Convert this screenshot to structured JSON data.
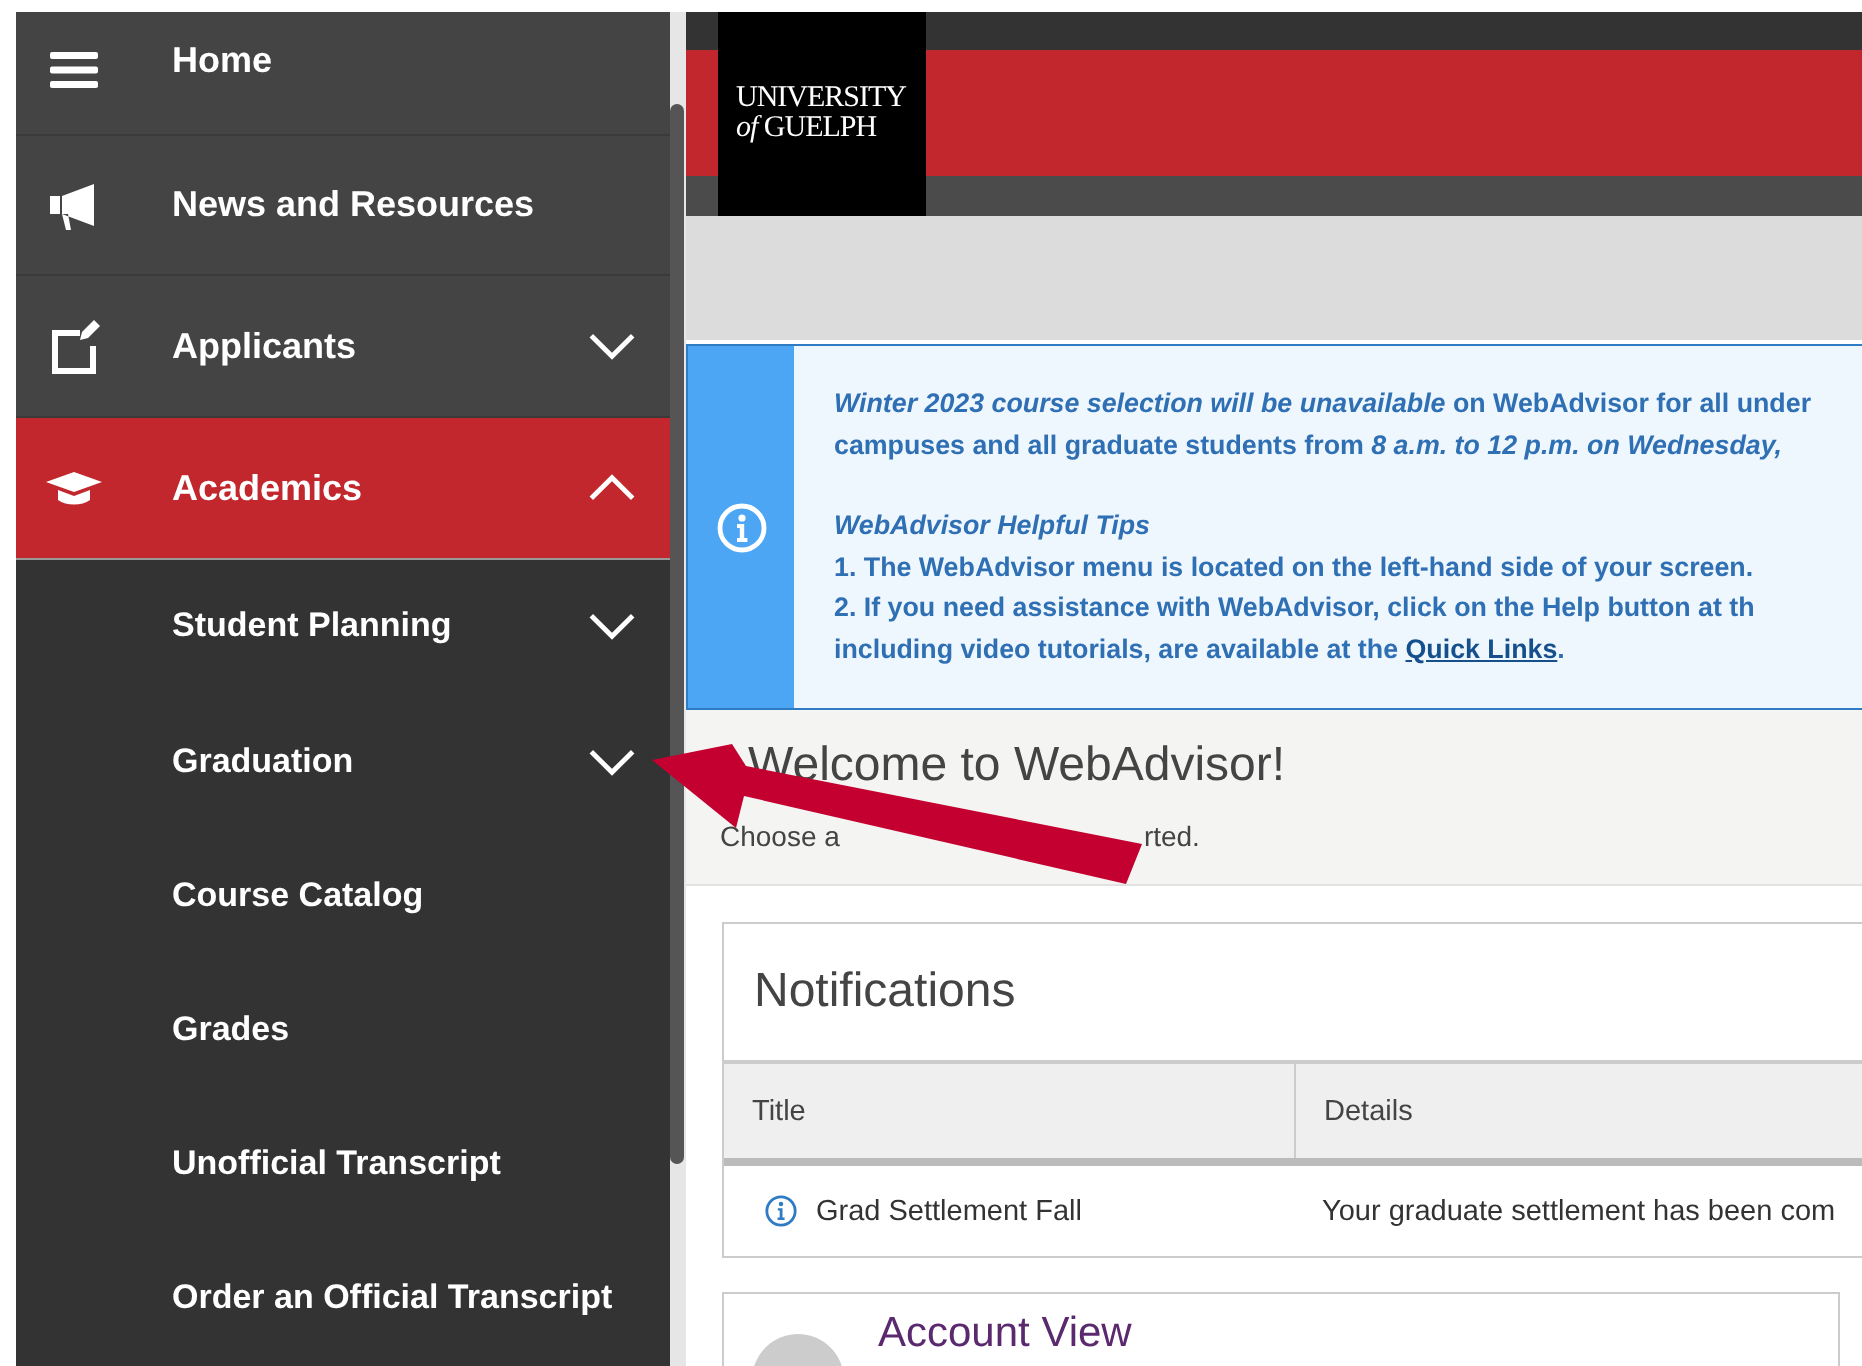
{
  "sidebar": {
    "items": [
      {
        "label": "Home",
        "selected": false
      },
      {
        "label": "News and Resources",
        "selected": false
      },
      {
        "label": "Applicants",
        "selected": false,
        "expanded": false
      },
      {
        "label": "Academics",
        "selected": true,
        "expanded": true,
        "children": [
          {
            "label": "Student Planning",
            "selected": false,
            "expanded": false
          },
          {
            "label": "Graduation",
            "selected": false,
            "expanded": false
          },
          {
            "label": "Course Catalog",
            "selected": false
          },
          {
            "label": "Grades",
            "selected": false
          },
          {
            "label": "Unofficial Transcript",
            "selected": false
          },
          {
            "label": "Order an Official Transcript",
            "selected": false
          }
        ]
      }
    ]
  },
  "header": {
    "logo": [
      "UNIVERSITY",
      "*of* GUELPH"
    ]
  },
  "banner": {
    "paragraphs": [
      [
        {
          "text": "*Winter 2023 course selection will be unavailable* on WebAdvisor for all under"
        },
        {
          "text": "campuses and all graduate students from *8 a.m. to 12 p.m. on Wednesday,*"
        }
      ],
      [
        {
          "text": "*WebAdvisor Helpful Tips*"
        },
        {
          "text": "1. The WebAdvisor menu is located on the left-hand side of your screen."
        },
        {
          "text": "2. If you need assistance with WebAdvisor, click on the Help button at th"
        },
        {
          "text": "including video tutorials, are available at the ",
          "link": "Quick Links",
          "after": "."
        }
      ]
    ]
  },
  "welcome": {
    "title": "Welcome to WebAdvisor!",
    "subtitle_parts": [
      "Choose a",
      "rted."
    ]
  },
  "notifications": {
    "title": "Notifications",
    "columns": [
      "Title",
      "Details"
    ],
    "rows": [
      {
        "title": "Grad Settlement Fall",
        "details": "Your graduate settlement has been com"
      }
    ]
  },
  "account_card": {
    "title": "Account View"
  }
}
